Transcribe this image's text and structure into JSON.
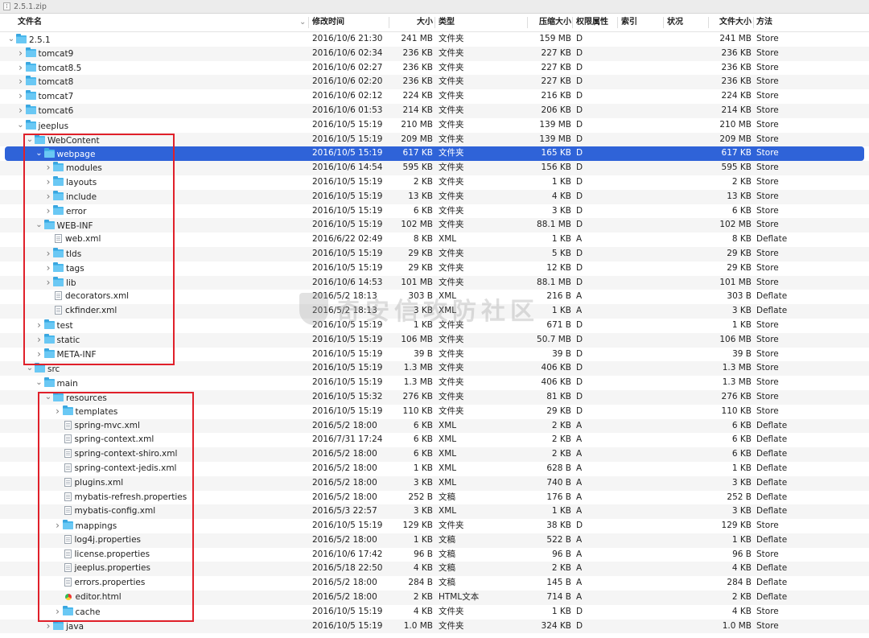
{
  "window": {
    "title": "2.5.1.zip",
    "icon": "zip-file-icon"
  },
  "columns": {
    "name": "文件名",
    "modified": "修改时间",
    "size": "大小",
    "kind": "类型",
    "compressed": "压缩大小",
    "permissions": "权限属性",
    "index": "索引",
    "status": "状况",
    "uncompressed": "文件大小",
    "method": "方法"
  },
  "watermark": "奇安信攻防社区",
  "rows": [
    {
      "depth": 0,
      "type": "folder",
      "exp": "open",
      "name": "2.5.1",
      "date": "2016/10/6 21:30",
      "size": "241 MB",
      "kind": "文件夹",
      "comp": "159 MB",
      "perm": "D",
      "usize": "241 MB",
      "method": "Store"
    },
    {
      "depth": 1,
      "type": "folder",
      "exp": "closed",
      "name": "tomcat9",
      "date": "2016/10/6 02:34",
      "size": "236 KB",
      "kind": "文件夹",
      "comp": "227 KB",
      "perm": "D",
      "usize": "236 KB",
      "method": "Store"
    },
    {
      "depth": 1,
      "type": "folder",
      "exp": "closed",
      "name": "tomcat8.5",
      "date": "2016/10/6 02:27",
      "size": "236 KB",
      "kind": "文件夹",
      "comp": "227 KB",
      "perm": "D",
      "usize": "236 KB",
      "method": "Store"
    },
    {
      "depth": 1,
      "type": "folder",
      "exp": "closed",
      "name": "tomcat8",
      "date": "2016/10/6 02:20",
      "size": "236 KB",
      "kind": "文件夹",
      "comp": "227 KB",
      "perm": "D",
      "usize": "236 KB",
      "method": "Store"
    },
    {
      "depth": 1,
      "type": "folder",
      "exp": "closed",
      "name": "tomcat7",
      "date": "2016/10/6 02:12",
      "size": "224 KB",
      "kind": "文件夹",
      "comp": "216 KB",
      "perm": "D",
      "usize": "224 KB",
      "method": "Store"
    },
    {
      "depth": 1,
      "type": "folder",
      "exp": "closed",
      "name": "tomcat6",
      "date": "2016/10/6 01:53",
      "size": "214 KB",
      "kind": "文件夹",
      "comp": "206 KB",
      "perm": "D",
      "usize": "214 KB",
      "method": "Store"
    },
    {
      "depth": 1,
      "type": "folder",
      "exp": "open",
      "name": "jeeplus",
      "date": "2016/10/5 15:19",
      "size": "210 MB",
      "kind": "文件夹",
      "comp": "139 MB",
      "perm": "D",
      "usize": "210 MB",
      "method": "Store"
    },
    {
      "depth": 2,
      "type": "folder",
      "exp": "open",
      "name": "WebContent",
      "date": "2016/10/5 15:19",
      "size": "209 MB",
      "kind": "文件夹",
      "comp": "139 MB",
      "perm": "D",
      "usize": "209 MB",
      "method": "Store"
    },
    {
      "depth": 3,
      "type": "folder",
      "exp": "open",
      "name": "webpage",
      "date": "2016/10/5 15:19",
      "size": "617 KB",
      "kind": "文件夹",
      "comp": "165 KB",
      "perm": "D",
      "usize": "617 KB",
      "method": "Store",
      "selected": true
    },
    {
      "depth": 4,
      "type": "folder",
      "exp": "closed",
      "name": "modules",
      "date": "2016/10/6 14:54",
      "size": "595 KB",
      "kind": "文件夹",
      "comp": "156 KB",
      "perm": "D",
      "usize": "595 KB",
      "method": "Store"
    },
    {
      "depth": 4,
      "type": "folder",
      "exp": "closed",
      "name": "layouts",
      "date": "2016/10/5 15:19",
      "size": "2 KB",
      "kind": "文件夹",
      "comp": "1 KB",
      "perm": "D",
      "usize": "2 KB",
      "method": "Store"
    },
    {
      "depth": 4,
      "type": "folder",
      "exp": "closed",
      "name": "include",
      "date": "2016/10/5 15:19",
      "size": "13 KB",
      "kind": "文件夹",
      "comp": "4 KB",
      "perm": "D",
      "usize": "13 KB",
      "method": "Store"
    },
    {
      "depth": 4,
      "type": "folder",
      "exp": "closed",
      "name": "error",
      "date": "2016/10/5 15:19",
      "size": "6 KB",
      "kind": "文件夹",
      "comp": "3 KB",
      "perm": "D",
      "usize": "6 KB",
      "method": "Store"
    },
    {
      "depth": 3,
      "type": "folder",
      "exp": "open",
      "name": "WEB-INF",
      "date": "2016/10/5 15:19",
      "size": "102 MB",
      "kind": "文件夹",
      "comp": "88.1 MB",
      "perm": "D",
      "usize": "102 MB",
      "method": "Store"
    },
    {
      "depth": 4,
      "type": "file",
      "exp": "none",
      "name": "web.xml",
      "date": "2016/6/22 02:49",
      "size": "8 KB",
      "kind": "XML",
      "comp": "1 KB",
      "perm": "A",
      "usize": "8 KB",
      "method": "Deflate"
    },
    {
      "depth": 4,
      "type": "folder",
      "exp": "closed",
      "name": "tlds",
      "date": "2016/10/5 15:19",
      "size": "29 KB",
      "kind": "文件夹",
      "comp": "5 KB",
      "perm": "D",
      "usize": "29 KB",
      "method": "Store"
    },
    {
      "depth": 4,
      "type": "folder",
      "exp": "closed",
      "name": "tags",
      "date": "2016/10/5 15:19",
      "size": "29 KB",
      "kind": "文件夹",
      "comp": "12 KB",
      "perm": "D",
      "usize": "29 KB",
      "method": "Store"
    },
    {
      "depth": 4,
      "type": "folder",
      "exp": "closed",
      "name": "lib",
      "date": "2016/10/6 14:53",
      "size": "101 MB",
      "kind": "文件夹",
      "comp": "88.1 MB",
      "perm": "D",
      "usize": "101 MB",
      "method": "Store"
    },
    {
      "depth": 4,
      "type": "file",
      "exp": "none",
      "name": "decorators.xml",
      "date": "2016/5/2 18:13",
      "size": "303 B",
      "kind": "XML",
      "comp": "216 B",
      "perm": "A",
      "usize": "303 B",
      "method": "Deflate"
    },
    {
      "depth": 4,
      "type": "file",
      "exp": "none",
      "name": "ckfinder.xml",
      "date": "2016/5/2 18:13",
      "size": "3 KB",
      "kind": "XML",
      "comp": "1 KB",
      "perm": "A",
      "usize": "3 KB",
      "method": "Deflate"
    },
    {
      "depth": 3,
      "type": "folder",
      "exp": "closed",
      "name": "test",
      "date": "2016/10/5 15:19",
      "size": "1 KB",
      "kind": "文件夹",
      "comp": "671 B",
      "perm": "D",
      "usize": "1 KB",
      "method": "Store"
    },
    {
      "depth": 3,
      "type": "folder",
      "exp": "closed",
      "name": "static",
      "date": "2016/10/5 15:19",
      "size": "106 MB",
      "kind": "文件夹",
      "comp": "50.7 MB",
      "perm": "D",
      "usize": "106 MB",
      "method": "Store"
    },
    {
      "depth": 3,
      "type": "folder",
      "exp": "closed",
      "name": "META-INF",
      "date": "2016/10/5 15:19",
      "size": "39 B",
      "kind": "文件夹",
      "comp": "39 B",
      "perm": "D",
      "usize": "39 B",
      "method": "Store"
    },
    {
      "depth": 2,
      "type": "folder",
      "exp": "open",
      "name": "src",
      "date": "2016/10/5 15:19",
      "size": "1.3 MB",
      "kind": "文件夹",
      "comp": "406 KB",
      "perm": "D",
      "usize": "1.3 MB",
      "method": "Store"
    },
    {
      "depth": 3,
      "type": "folder",
      "exp": "open",
      "name": "main",
      "date": "2016/10/5 15:19",
      "size": "1.3 MB",
      "kind": "文件夹",
      "comp": "406 KB",
      "perm": "D",
      "usize": "1.3 MB",
      "method": "Store"
    },
    {
      "depth": 4,
      "type": "folder",
      "exp": "open",
      "name": "resources",
      "date": "2016/10/5 15:32",
      "size": "276 KB",
      "kind": "文件夹",
      "comp": "81 KB",
      "perm": "D",
      "usize": "276 KB",
      "method": "Store"
    },
    {
      "depth": 5,
      "type": "folder",
      "exp": "closed",
      "name": "templates",
      "date": "2016/10/5 15:19",
      "size": "110 KB",
      "kind": "文件夹",
      "comp": "29 KB",
      "perm": "D",
      "usize": "110 KB",
      "method": "Store"
    },
    {
      "depth": 5,
      "type": "file",
      "exp": "none",
      "name": "spring-mvc.xml",
      "date": "2016/5/2 18:00",
      "size": "6 KB",
      "kind": "XML",
      "comp": "2 KB",
      "perm": "A",
      "usize": "6 KB",
      "method": "Deflate"
    },
    {
      "depth": 5,
      "type": "file",
      "exp": "none",
      "name": "spring-context.xml",
      "date": "2016/7/31 17:24",
      "size": "6 KB",
      "kind": "XML",
      "comp": "2 KB",
      "perm": "A",
      "usize": "6 KB",
      "method": "Deflate"
    },
    {
      "depth": 5,
      "type": "file",
      "exp": "none",
      "name": "spring-context-shiro.xml",
      "date": "2016/5/2 18:00",
      "size": "6 KB",
      "kind": "XML",
      "comp": "2 KB",
      "perm": "A",
      "usize": "6 KB",
      "method": "Deflate"
    },
    {
      "depth": 5,
      "type": "file",
      "exp": "none",
      "name": "spring-context-jedis.xml",
      "date": "2016/5/2 18:00",
      "size": "1 KB",
      "kind": "XML",
      "comp": "628 B",
      "perm": "A",
      "usize": "1 KB",
      "method": "Deflate"
    },
    {
      "depth": 5,
      "type": "file",
      "exp": "none",
      "name": "plugins.xml",
      "date": "2016/5/2 18:00",
      "size": "3 KB",
      "kind": "XML",
      "comp": "740 B",
      "perm": "A",
      "usize": "3 KB",
      "method": "Deflate"
    },
    {
      "depth": 5,
      "type": "file",
      "exp": "none",
      "name": "mybatis-refresh.properties",
      "date": "2016/5/2 18:00",
      "size": "252 B",
      "kind": "文稿",
      "comp": "176 B",
      "perm": "A",
      "usize": "252 B",
      "method": "Deflate"
    },
    {
      "depth": 5,
      "type": "file",
      "exp": "none",
      "name": "mybatis-config.xml",
      "date": "2016/5/3 22:57",
      "size": "3 KB",
      "kind": "XML",
      "comp": "1 KB",
      "perm": "A",
      "usize": "3 KB",
      "method": "Deflate"
    },
    {
      "depth": 5,
      "type": "folder",
      "exp": "closed",
      "name": "mappings",
      "date": "2016/10/5 15:19",
      "size": "129 KB",
      "kind": "文件夹",
      "comp": "38 KB",
      "perm": "D",
      "usize": "129 KB",
      "method": "Store"
    },
    {
      "depth": 5,
      "type": "file",
      "exp": "none",
      "name": "log4j.properties",
      "date": "2016/5/2 18:00",
      "size": "1 KB",
      "kind": "文稿",
      "comp": "522 B",
      "perm": "A",
      "usize": "1 KB",
      "method": "Deflate"
    },
    {
      "depth": 5,
      "type": "file",
      "exp": "none",
      "name": "license.properties",
      "date": "2016/10/6 17:42",
      "size": "96 B",
      "kind": "文稿",
      "comp": "96 B",
      "perm": "A",
      "usize": "96 B",
      "method": "Store"
    },
    {
      "depth": 5,
      "type": "file",
      "exp": "none",
      "name": "jeeplus.properties",
      "date": "2016/5/18 22:50",
      "size": "4 KB",
      "kind": "文稿",
      "comp": "2 KB",
      "perm": "A",
      "usize": "4 KB",
      "method": "Deflate"
    },
    {
      "depth": 5,
      "type": "file",
      "exp": "none",
      "name": "errors.properties",
      "date": "2016/5/2 18:00",
      "size": "284 B",
      "kind": "文稿",
      "comp": "145 B",
      "perm": "A",
      "usize": "284 B",
      "method": "Deflate"
    },
    {
      "depth": 5,
      "type": "html",
      "exp": "none",
      "name": "editor.html",
      "date": "2016/5/2 18:00",
      "size": "2 KB",
      "kind": "HTML文本",
      "comp": "714 B",
      "perm": "A",
      "usize": "2 KB",
      "method": "Deflate"
    },
    {
      "depth": 5,
      "type": "folder",
      "exp": "closed",
      "name": "cache",
      "date": "2016/10/5 15:19",
      "size": "4 KB",
      "kind": "文件夹",
      "comp": "1 KB",
      "perm": "D",
      "usize": "4 KB",
      "method": "Store"
    },
    {
      "depth": 4,
      "type": "folder",
      "exp": "closed",
      "name": "java",
      "date": "2016/10/5 15:19",
      "size": "1.0 MB",
      "kind": "文件夹",
      "comp": "324 KB",
      "perm": "D",
      "usize": "1.0 MB",
      "method": "Store"
    }
  ]
}
